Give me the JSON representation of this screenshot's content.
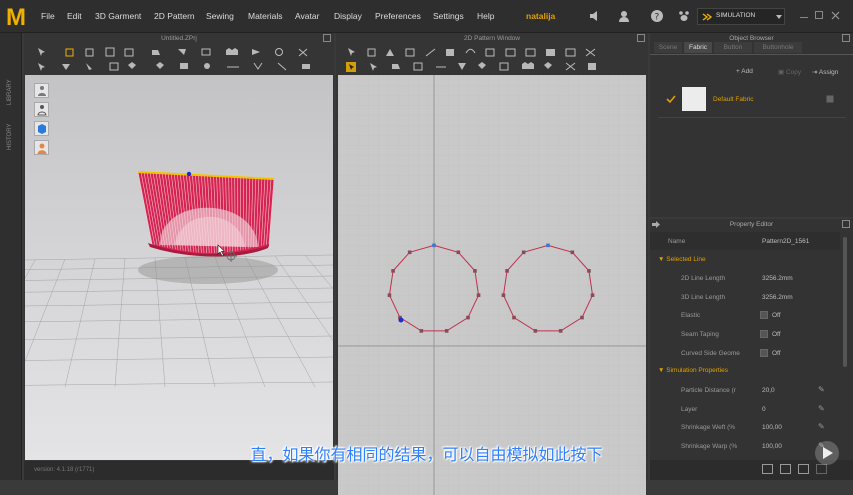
{
  "app": {
    "logo": "M"
  },
  "menu": [
    "File",
    "Edit",
    "3D Garment",
    "2D Pattern",
    "Sewing",
    "Materials",
    "Avatar",
    "Display",
    "Preferences",
    "Settings",
    "Help"
  ],
  "user": {
    "name": "natalija"
  },
  "mode": {
    "label": "SIMULATION"
  },
  "left_strip": {
    "items": [
      "LIBRARY",
      "HISTORY"
    ]
  },
  "panel3d": {
    "title": "Untitled.ZPrj",
    "version_text": "version: 4.1.18 (r1771)"
  },
  "panel2d": {
    "title": "2D Pattern Window"
  },
  "object_browser": {
    "title": "Object Browser",
    "tabs": [
      "Scene",
      "Fabric",
      "Button",
      "Buttonhole"
    ],
    "active_tab": "Fabric",
    "actions": {
      "add": "Add",
      "copy": "Copy",
      "assign": "Assign"
    },
    "fabric_item": "Default Fabric"
  },
  "property_editor": {
    "title": "Property Editor",
    "name_label": "Name",
    "name_value": "Pattern2D_1561",
    "section_selected_line": "Selected Line",
    "rows_line": [
      {
        "label": "2D Line Length",
        "value": "3256.2mm"
      },
      {
        "label": "3D Line Length",
        "value": "3256.2mm"
      }
    ],
    "rows_toggle": [
      {
        "label": "Elastic",
        "value": "Off"
      },
      {
        "label": "Seam Taping",
        "value": "Off"
      },
      {
        "label": "Curved Side Geome",
        "value": "Off"
      }
    ],
    "section_sim": "Simulation Properties",
    "rows_sim": [
      {
        "label": "Particle Distance (r",
        "value": "20,0"
      },
      {
        "label": "Layer",
        "value": "0"
      },
      {
        "label": "Shrinkage Weft (%",
        "value": "100,00"
      },
      {
        "label": "Shrinkage Warp (%",
        "value": "100,00"
      }
    ]
  },
  "subtitle": "直，如果你有相同的结果，可以自由模拟如此按下",
  "colors": {
    "accent": "#e0a000",
    "garment": "#d62452",
    "pattern_line": "#c0304f",
    "subtitle": "#2f7fff"
  },
  "icons": [
    "play-icon"
  ]
}
